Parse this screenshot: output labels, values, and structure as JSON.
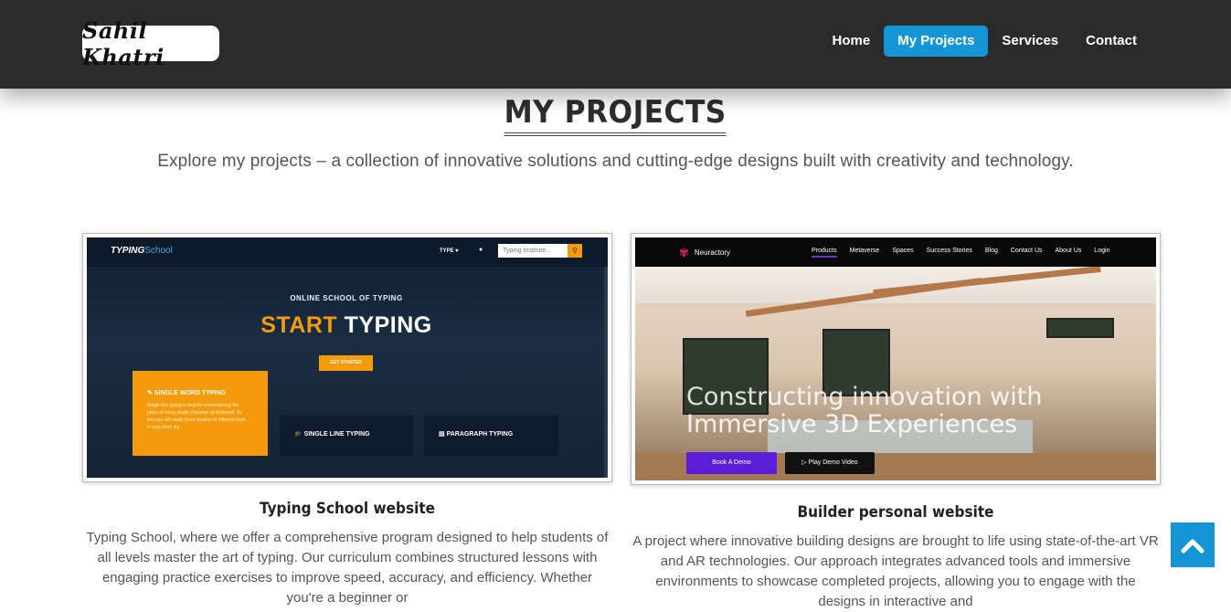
{
  "header": {
    "logo": "Sahil Khatri",
    "nav": [
      {
        "label": "Home"
      },
      {
        "label": "My Projects"
      },
      {
        "label": "Services"
      },
      {
        "label": "Contact"
      }
    ],
    "active_color": "#1594d6",
    "background": "#2b2b2b"
  },
  "page": {
    "title": "MY PROJECTS",
    "subtitle": "Explore my projects – a collection of innovative solutions and cutting-edge designs built with creativity and technology."
  },
  "projects": [
    {
      "title": "Typing School website",
      "description": "Typing School, where we offer a comprehensive program designed to help students of all levels master the art of typing. Our curriculum combines structured lessons with engaging practice exercises to improve speed, accuracy, and efficiency. Whether you're a beginner or",
      "screenshot": {
        "logo_bold": "TYPING",
        "logo_rest": "School",
        "menu": "TYPE ▾",
        "search_placeholder": "Typing Institute...",
        "kicker": "ONLINE SCHOOL OF TYPING",
        "headline_accent": "START",
        "headline_rest": "TYPING",
        "cta": "GET STARTED",
        "card1_title": "SINGLE WORD TYPING",
        "card1_text": "Single line typing is best for remembering the place of every single character at keyboard. By this you will easily learn location of different keys in very short tim",
        "card2_title": "SINGLE LINE TYPING",
        "card3_title": "PARAGRAPH TYPING"
      }
    },
    {
      "title": "Builder personal website",
      "description": "A project where innovative building designs are brought to life using state-of-the-art VR and AR technologies. Our approach integrates advanced tools and immersive environments to showcase completed projects, allowing you to engage with the designs in interactive and",
      "screenshot": {
        "brand": "Neuractory",
        "menu": [
          "Products",
          "Metaverse",
          "Spaces",
          "Success Stories",
          "Blog",
          "Contact Us",
          "About Us",
          "Login"
        ],
        "headline_line1": "Constructing innovation with",
        "headline_line2": "Immersive 3D Experiences",
        "button_demo": "Book A Demo",
        "button_video": "▷ Play Demo Video"
      }
    }
  ]
}
